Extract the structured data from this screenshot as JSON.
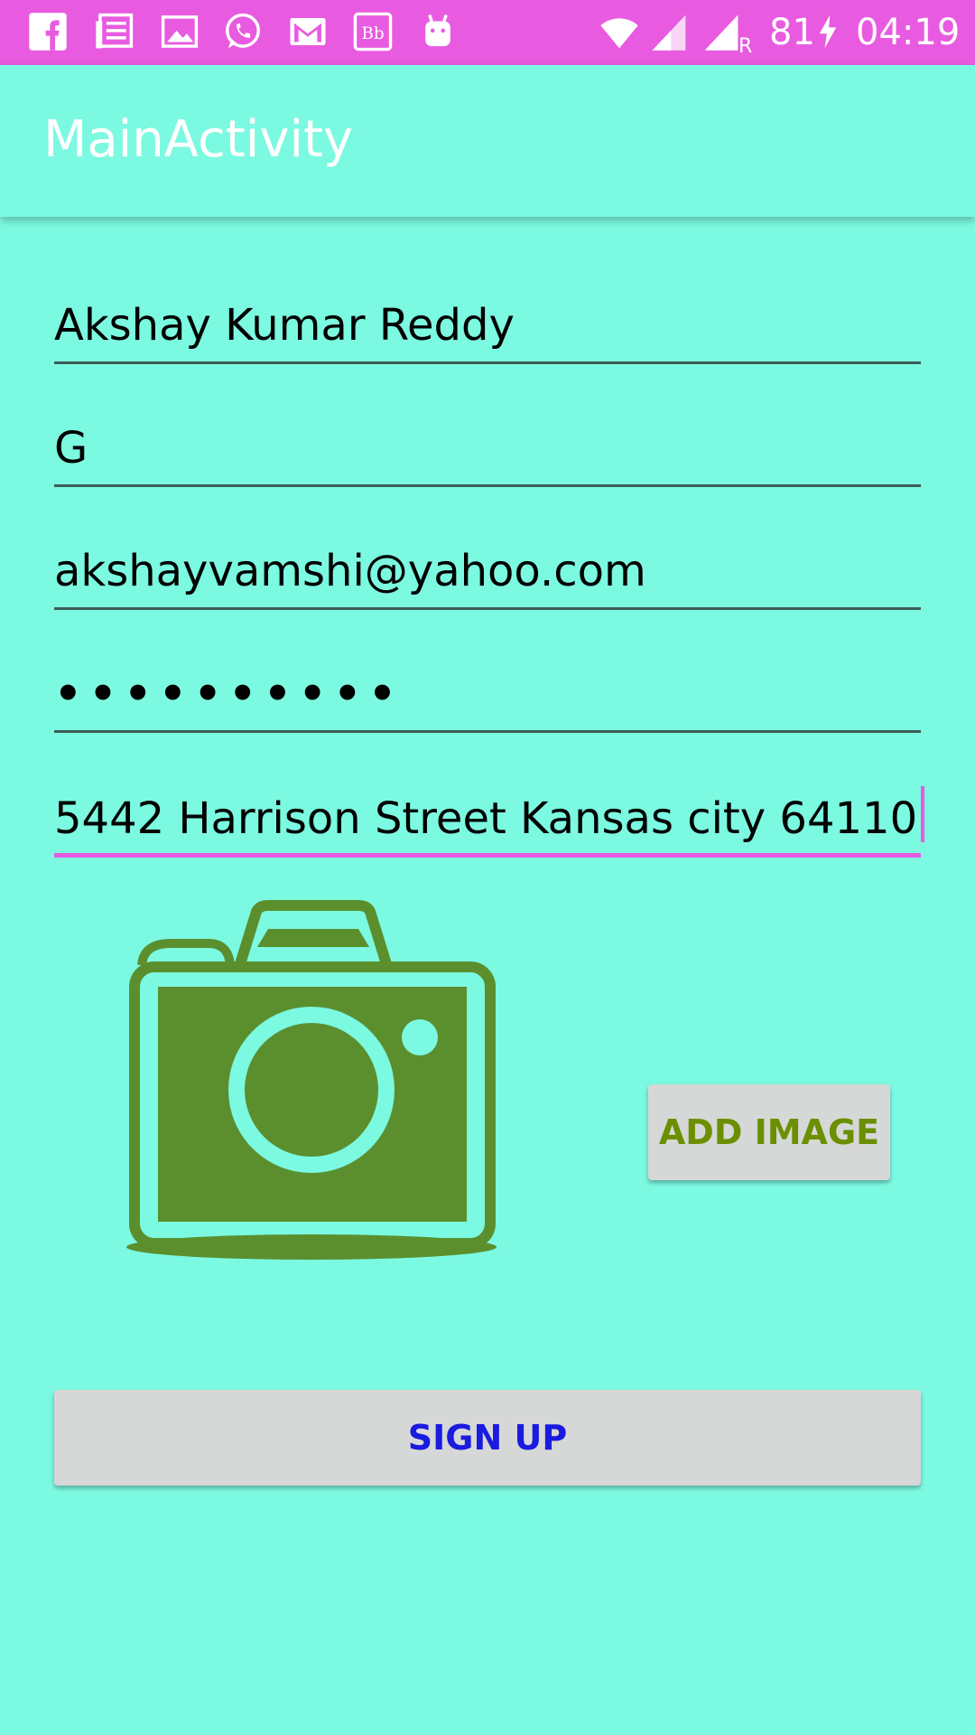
{
  "status_bar": {
    "battery": "81",
    "time": "04:19",
    "network_label": "R",
    "color": "#e85be0",
    "icons": [
      "facebook-icon",
      "news-icon",
      "gallery-icon",
      "whatsapp-icon",
      "gmail-icon",
      "blackboard-icon",
      "android-icon",
      "wifi-icon",
      "signal-icon",
      "signal-roaming-icon",
      "charging-icon"
    ]
  },
  "app_bar": {
    "title": "MainActivity",
    "background": "#7cf9e1"
  },
  "form": {
    "first_name": "Akshay Kumar Reddy",
    "last_name": "G",
    "email": "akshayvamshi@yahoo.com",
    "password_mask": "••••••••••",
    "address": "5442 Harrison Street Kansas city 64110",
    "active_field": "address",
    "accent_color": "#e85be0"
  },
  "image": {
    "icon": "camera-icon",
    "color": "#5b8f2e"
  },
  "buttons": {
    "add_image": "ADD IMAGE",
    "sign_up": "SIGN UP"
  }
}
